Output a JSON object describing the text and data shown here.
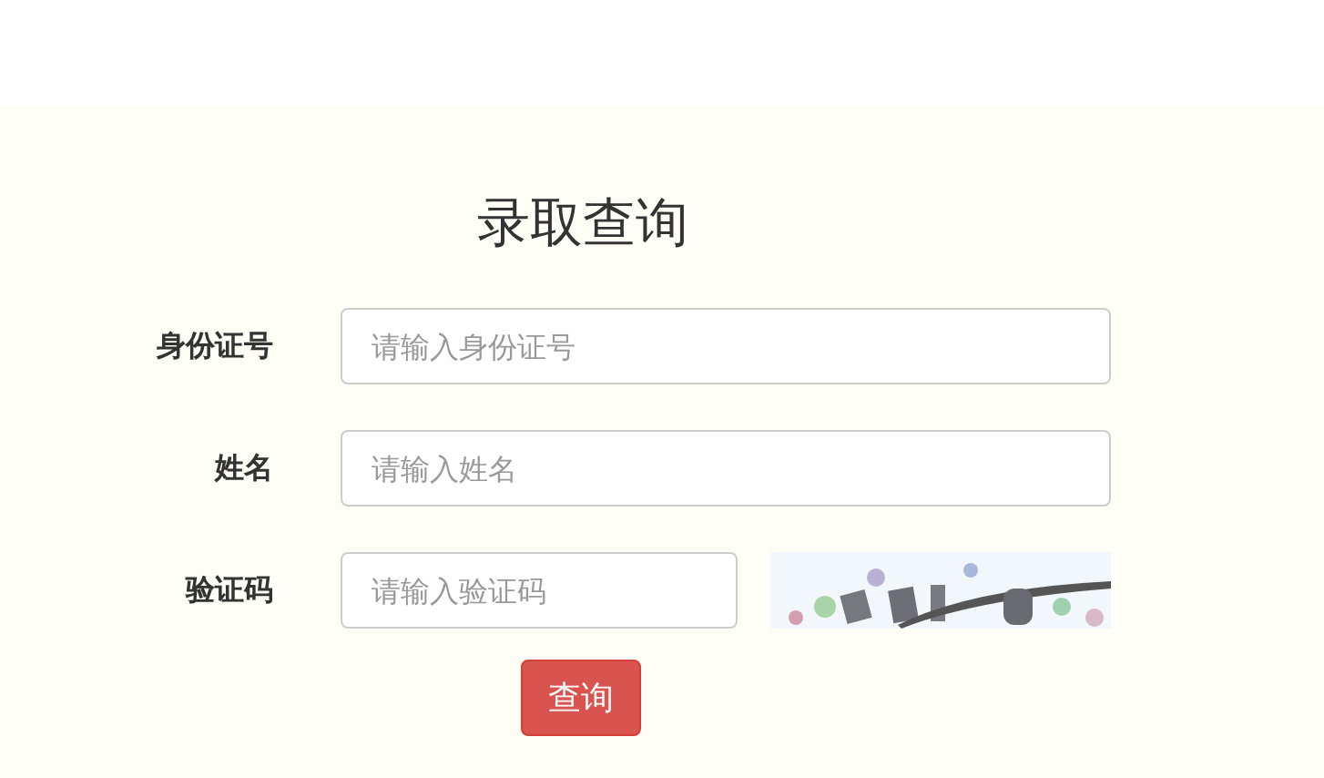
{
  "title": "录取查询",
  "fields": [
    {
      "label": "身份证号",
      "placeholder": "请输入身份证号",
      "kind": "text"
    },
    {
      "label": "姓名",
      "placeholder": "请输入姓名",
      "kind": "text"
    },
    {
      "label": "验证码",
      "placeholder": "请输入验证码",
      "kind": "captcha"
    }
  ],
  "submit": "查询"
}
